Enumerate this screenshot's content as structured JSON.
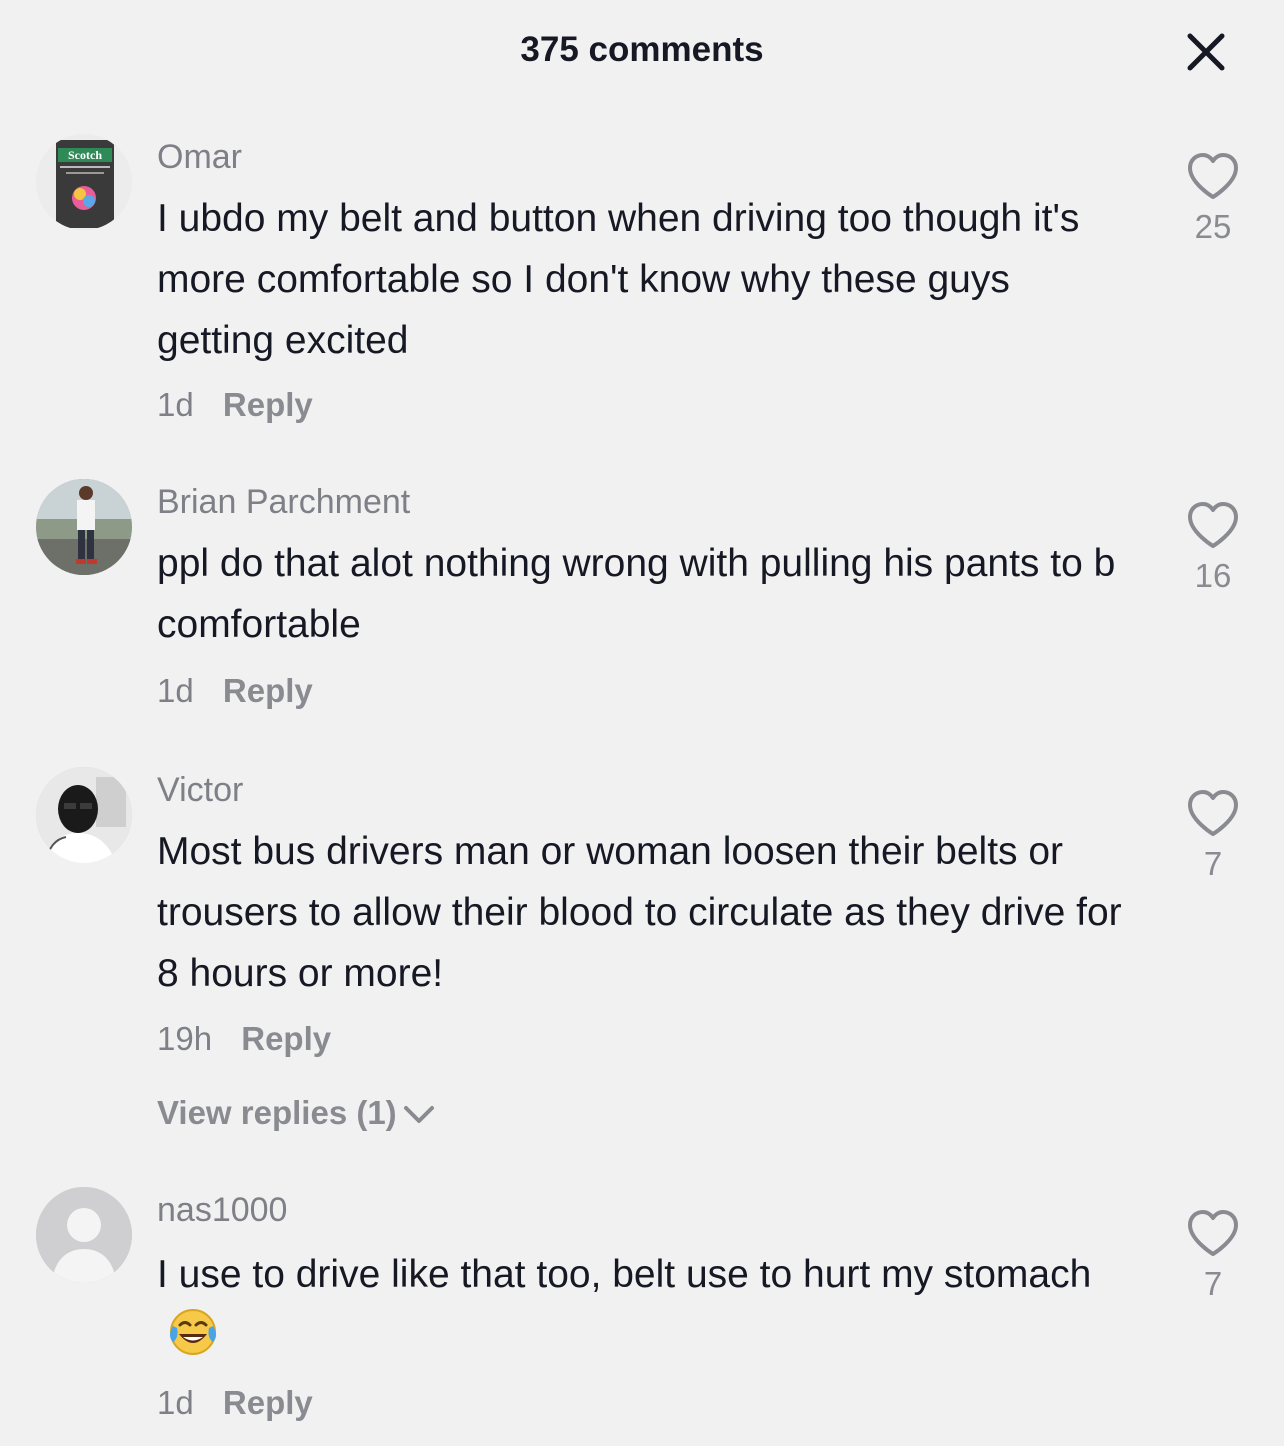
{
  "header": {
    "title": "375 comments",
    "close_icon": "close-icon"
  },
  "comments": [
    {
      "username": "Omar",
      "text": "I ubdo my belt and button when driving too though it's more comfortable so I don't know why these guys getting excited",
      "time": "1d",
      "reply_label": "Reply",
      "likes": "25",
      "avatar_text": "Scotch"
    },
    {
      "username": "Brian Parchment",
      "text": "ppl do that alot nothing wrong with pulling his pants to b comfortable",
      "time": "1d",
      "reply_label": "Reply",
      "likes": "16"
    },
    {
      "username": "Victor",
      "text": "Most bus drivers man or woman loosen their belts or trousers to allow their blood to circulate as they drive for 8 hours or more!",
      "time": "19h",
      "reply_label": "Reply",
      "likes": "7",
      "view_replies": "View replies (1)"
    },
    {
      "username": "nas1000",
      "text": "I use to drive like that too, belt use to hurt my stomach",
      "emoji": "face-with-tears-of-joy",
      "time": "1d",
      "reply_label": "Reply",
      "likes": "7"
    }
  ]
}
